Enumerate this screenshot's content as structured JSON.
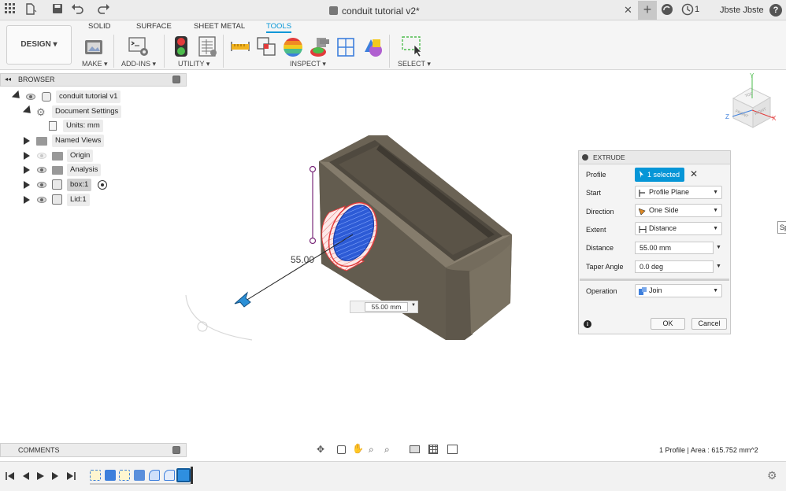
{
  "titlebar": {
    "document_title": "conduit tutorial v2*",
    "job_count": "1",
    "user_name": "Jbste Jbste",
    "help_label": "?"
  },
  "toolbar": {
    "workspace": "DESIGN",
    "tabs": [
      "SOLID",
      "SURFACE",
      "SHEET METAL",
      "TOOLS"
    ],
    "active_tab": "TOOLS",
    "groups": [
      "MAKE",
      "ADD-INS",
      "UTILITY",
      "INSPECT",
      "SELECT"
    ]
  },
  "browser": {
    "title": "BROWSER",
    "items": [
      {
        "label": "conduit tutorial v1"
      },
      {
        "label": "Document Settings"
      },
      {
        "label": "Units: mm"
      },
      {
        "label": "Named Views"
      },
      {
        "label": "Origin"
      },
      {
        "label": "Analysis"
      },
      {
        "label": "box:1"
      },
      {
        "label": "Lid:1"
      }
    ]
  },
  "viewport": {
    "dimension_label": "55.00",
    "distance_value": "55.00 mm",
    "viewcube_faces": [
      "TOP",
      "FRONT",
      "RIGHT"
    ],
    "axis_labels": [
      "Y",
      "Z",
      "X"
    ]
  },
  "extrude": {
    "title": "EXTRUDE",
    "profile_label": "Profile",
    "profile_value": "1 selected",
    "start_label": "Start",
    "start_value": "Profile Plane",
    "direction_label": "Direction",
    "direction_value": "One Side",
    "extent_label": "Extent",
    "extent_value": "Distance",
    "distance_label": "Distance",
    "distance_value": "55.00 mm",
    "taper_label": "Taper Angle",
    "taper_value": "0.0 deg",
    "operation_label": "Operation",
    "operation_value": "Join",
    "ok_label": "OK",
    "cancel_label": "Cancel"
  },
  "comments": {
    "title": "COMMENTS"
  },
  "status": {
    "text": "1 Profile | Area : 615.752 mm^2"
  },
  "side_tab_partial": "Sp",
  "colors": {
    "accent": "#0696d7",
    "body": "#6b6355",
    "profile": "#2d5bd6",
    "profile_edge": "#e23b3b"
  }
}
